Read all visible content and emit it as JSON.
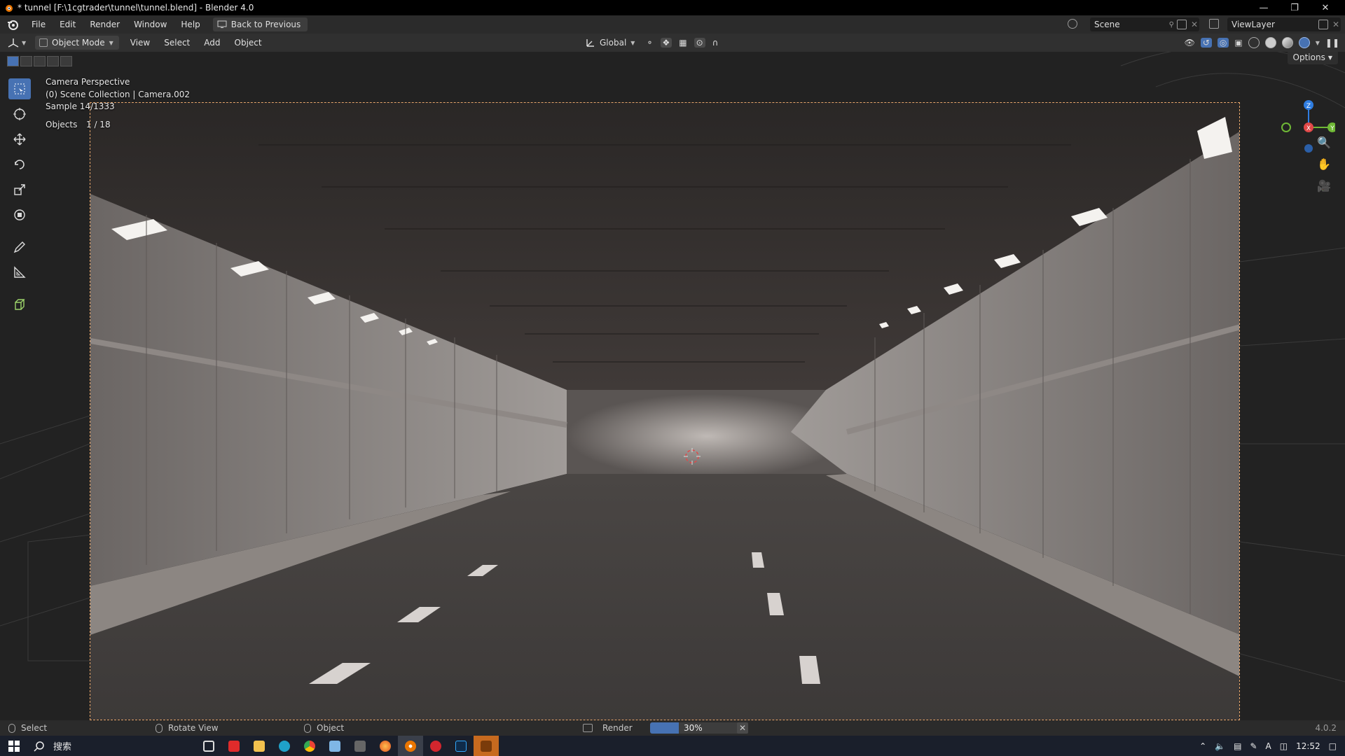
{
  "window": {
    "title": "* tunnel [F:\\1cgtrader\\tunnel\\tunnel.blend] - Blender 4.0",
    "controls": [
      "minimize",
      "restore",
      "close"
    ]
  },
  "menubar": {
    "items": [
      "File",
      "Edit",
      "Render",
      "Window",
      "Help"
    ],
    "back_button": "Back to Previous",
    "scene_label": "Scene",
    "view_layer_label": "ViewLayer"
  },
  "viewport_header": {
    "mode": "Object Mode",
    "menus": [
      "View",
      "Select",
      "Add",
      "Object"
    ],
    "transform_orientation": "Global",
    "options_label": "Options"
  },
  "viewport_overlay": {
    "view_name": "Camera Perspective",
    "collection": "(0) Scene Collection | Camera.002",
    "sample": "Sample 14/1333",
    "objects_label": "Objects",
    "objects_count": "1 / 18"
  },
  "gizmo": {
    "z": "Z",
    "x": "X",
    "y": "Y"
  },
  "statusbar": {
    "select": "Select",
    "rotate": "Rotate View",
    "object": "Object",
    "render_label": "Render",
    "progress_text": "30%",
    "progress_value": 0.3,
    "version": "4.0.2"
  },
  "taskbar": {
    "search_label": "搜索",
    "time": "12:52",
    "ime": "A"
  },
  "colors": {
    "accent": "#4772b3",
    "camera_frame": "#e7a56b"
  }
}
